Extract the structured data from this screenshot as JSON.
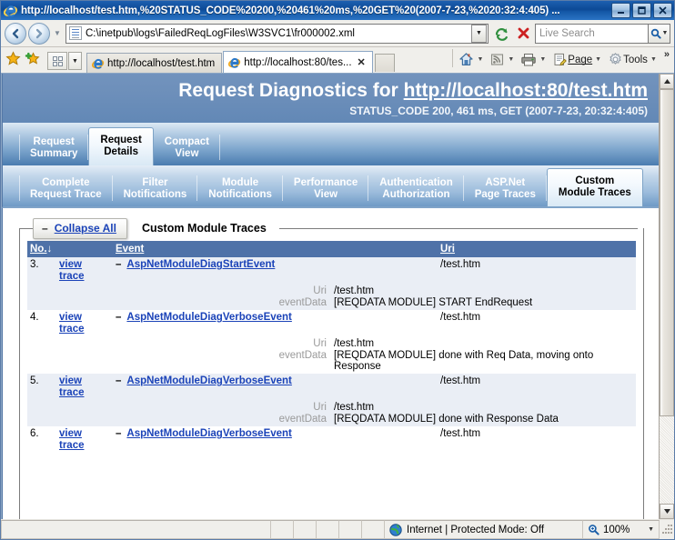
{
  "window": {
    "title": "http://localhost/test.htm,%20STATUS_CODE%20200,%20461%20ms,%20GET%20(2007-7-23,%2020:32:4:405) ...",
    "minimize_label": "_",
    "maximize_label": "□",
    "close_label": "✕"
  },
  "navigation": {
    "back_label": "Back",
    "forward_label": "Forward",
    "recent_pages_label": "Recent Pages",
    "address_value": "C:\\inetpub\\logs\\FailedReqLogFiles\\W3SVC1\\fr000002.xml",
    "address_dropdown_label": "▼",
    "refresh_label": "Refresh",
    "stop_label": "Stop",
    "search_placeholder": "Live Search",
    "search_button_label": "Search",
    "search_dropdown_label": "▼"
  },
  "tabbar": {
    "favorites_label": "Favorites Center",
    "add_favorites_label": "Add to Favorites",
    "quick_tabs_label": "Quick Tabs",
    "quick_tabs_dropdown_label": "▼",
    "tabs": [
      {
        "label": "http://localhost/test.htm",
        "active": false,
        "closable": false
      },
      {
        "label": "http://localhost:80/tes...",
        "active": true,
        "closable": true,
        "close_label": "✕"
      }
    ],
    "new_tab_label": "New Tab",
    "commands": [
      {
        "label": "",
        "icon": "home-icon",
        "dropdown": "▼"
      },
      {
        "label": "",
        "icon": "feeds-icon",
        "dropdown": "▼"
      },
      {
        "label": "",
        "icon": "print-icon",
        "dropdown": "▼"
      },
      {
        "label": "Page",
        "icon": "page-icon",
        "dropdown": "▼"
      },
      {
        "label": "Tools",
        "icon": "tools-icon",
        "dropdown": "▼"
      }
    ],
    "overflow_label": "»"
  },
  "banner": {
    "title_prefix": "Request Diagnostics for ",
    "title_url": "http://localhost:80/test.htm",
    "subtitle": "STATUS_CODE 200, 461 ms, GET (2007-7-23, 20:32:4:405)"
  },
  "primary_tabs": [
    {
      "line1": "Request",
      "line2": "Summary",
      "selected": false
    },
    {
      "line1": "Request",
      "line2": "Details",
      "selected": true
    },
    {
      "line1": "Compact",
      "line2": "View",
      "selected": false
    }
  ],
  "secondary_tabs": [
    {
      "line1": "Complete",
      "line2": "Request Trace",
      "selected": false
    },
    {
      "line1": "Filter",
      "line2": "Notifications",
      "selected": false
    },
    {
      "line1": "Module",
      "line2": "Notifications",
      "selected": false
    },
    {
      "line1": "Performance",
      "line2": "View",
      "selected": false
    },
    {
      "line1": "Authentication",
      "line2": "Authorization",
      "selected": false
    },
    {
      "line1": "ASP.Net",
      "line2": "Page Traces",
      "selected": false
    },
    {
      "line1": "Custom",
      "line2": "Module Traces",
      "selected": true
    }
  ],
  "section": {
    "collapse_minus": "–",
    "collapse_label": "Collapse All",
    "title": "Custom Module Traces"
  },
  "table": {
    "columns": {
      "no": "No.",
      "no_sort": "↓",
      "view": "",
      "event": "Event",
      "uri": "Uri"
    },
    "rows": [
      {
        "no": "3.",
        "view_line1": "view",
        "view_line2": "trace",
        "expander": "–",
        "event": "AspNetModuleDiagStartEvent",
        "uri": "/test.htm",
        "details": [
          {
            "key": "Uri",
            "value": "/test.htm"
          },
          {
            "key": "eventData",
            "value": "[REQDATA MODULE] START EndRequest"
          }
        ]
      },
      {
        "no": "4.",
        "view_line1": "view",
        "view_line2": "trace",
        "expander": "–",
        "event": "AspNetModuleDiagVerboseEvent",
        "uri": "/test.htm",
        "details": [
          {
            "key": "Uri",
            "value": "/test.htm"
          },
          {
            "key": "eventData",
            "value": "[REQDATA MODULE] done with Req Data, moving onto Response"
          }
        ]
      },
      {
        "no": "5.",
        "view_line1": "view",
        "view_line2": "trace",
        "expander": "–",
        "event": "AspNetModuleDiagVerboseEvent",
        "uri": "/test.htm",
        "details": [
          {
            "key": "Uri",
            "value": "/test.htm"
          },
          {
            "key": "eventData",
            "value": "[REQDATA MODULE] done with Response Data"
          }
        ]
      },
      {
        "no": "6.",
        "view_line1": "view",
        "view_line2": "trace",
        "expander": "–",
        "event": "AspNetModuleDiagVerboseEvent",
        "uri": "/test.htm",
        "details": []
      }
    ]
  },
  "statusbar": {
    "message": "",
    "zone": "Internet | Protected Mode: Off",
    "zoom": "100%",
    "zoom_dropdown": "▼"
  },
  "colors": {
    "accent_blue": "#1b43b8",
    "banner_blue": "#6d8fba",
    "header_row": "#4f72a8",
    "row_alt": "#eaeef5",
    "title_bar": "#0d4a96"
  }
}
